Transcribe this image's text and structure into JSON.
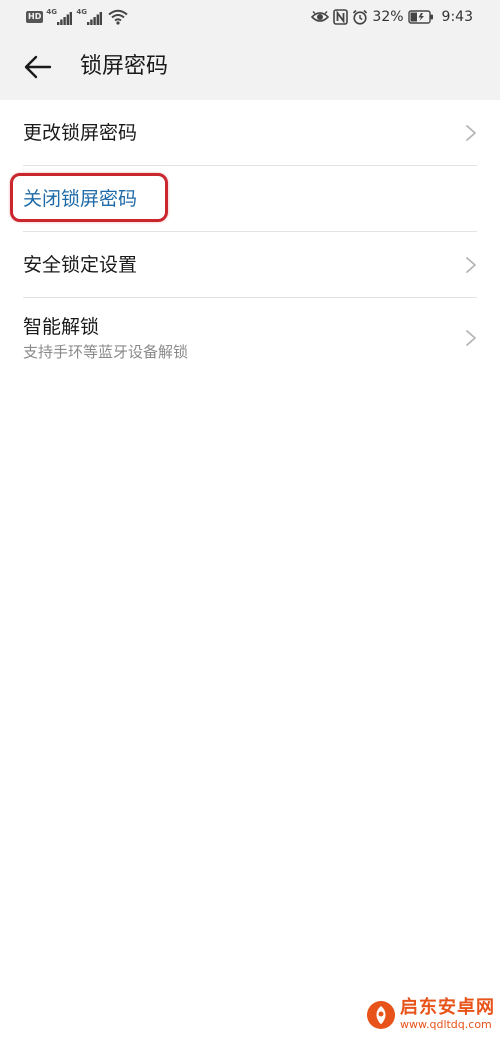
{
  "status_bar": {
    "hd_label": "HD",
    "sim1_network": "4G",
    "sim2_network": "4G",
    "battery_percent": "32%",
    "time": "9:43",
    "icons": [
      "signal-icon",
      "wifi-icon",
      "eye-icon",
      "nfc-icon",
      "alarm-icon",
      "battery-icon"
    ]
  },
  "header": {
    "title": "锁屏密码",
    "back_icon": "back-arrow-icon"
  },
  "list": {
    "items": [
      {
        "label": "更改锁屏密码",
        "sublabel": ""
      },
      {
        "label": "关闭锁屏密码",
        "sublabel": ""
      },
      {
        "label": "安全锁定设置",
        "sublabel": ""
      },
      {
        "label": "智能解锁",
        "sublabel": "支持手环等蓝牙设备解锁"
      }
    ]
  },
  "watermark": {
    "name": "启东安卓网",
    "url": "www.qdltdq.com"
  },
  "colors": {
    "accent": "#1f6aa8",
    "highlight": "#c9262e",
    "header_bg": "#f2f2f2",
    "watermark": "#e8531a"
  }
}
